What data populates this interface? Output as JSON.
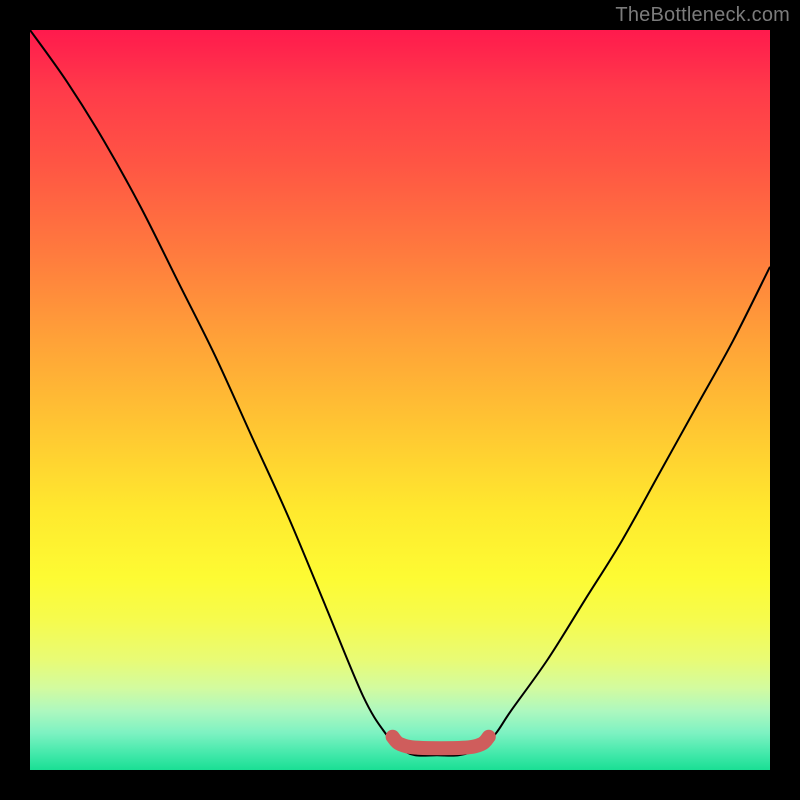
{
  "watermark": "TheBottleneck.com",
  "colors": {
    "background": "#000000",
    "curve": "#000000",
    "trough_highlight": "#cf5d5c",
    "watermark": "#7b7b7b",
    "gradient_stops": [
      "#ff1a4d",
      "#ff3a4a",
      "#ff5544",
      "#ff7a3e",
      "#ffa238",
      "#ffc732",
      "#ffe92e",
      "#fdfb33",
      "#f5fb4f",
      "#e9fb74",
      "#d2fba0",
      "#aef8bf",
      "#7df2c2",
      "#3fe8a9",
      "#1adf94"
    ]
  },
  "chart_data": {
    "type": "line",
    "title": "",
    "xlabel": "",
    "ylabel": "",
    "xlim": [
      0,
      1
    ],
    "ylim": [
      0,
      1
    ],
    "note": "Axes unlabeled; x/y normalized 0–1. y is the height of the black curve (0 = bottom/green, 1 = top/red). Bottleneck-style V curve with minimum plateau near x≈0.50–0.61.",
    "x": [
      0.0,
      0.05,
      0.1,
      0.15,
      0.2,
      0.25,
      0.3,
      0.35,
      0.4,
      0.45,
      0.48,
      0.5,
      0.52,
      0.55,
      0.58,
      0.61,
      0.63,
      0.65,
      0.7,
      0.75,
      0.8,
      0.85,
      0.9,
      0.95,
      1.0
    ],
    "y": [
      1.0,
      0.93,
      0.85,
      0.76,
      0.66,
      0.56,
      0.45,
      0.34,
      0.22,
      0.1,
      0.05,
      0.03,
      0.02,
      0.02,
      0.02,
      0.03,
      0.05,
      0.08,
      0.15,
      0.23,
      0.31,
      0.4,
      0.49,
      0.58,
      0.68
    ],
    "trough_highlight": {
      "x_start": 0.49,
      "x_end": 0.62,
      "y_approx": 0.03
    }
  }
}
